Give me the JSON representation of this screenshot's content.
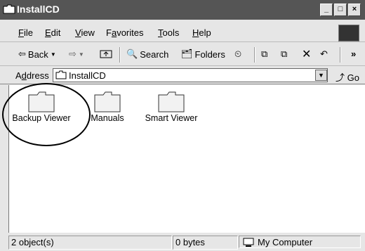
{
  "window": {
    "title": "InstallCD"
  },
  "menubar": {
    "file": "ile",
    "edit": "dit",
    "view": "iew",
    "favorites_pre": "F",
    "favorites_u": "a",
    "favorites_post": "vorites",
    "tools": "ools",
    "help": "elp"
  },
  "toolbar": {
    "back": "Back",
    "search": "Search",
    "folders": "Folders"
  },
  "address": {
    "label_u": "d",
    "label_pre": "A",
    "label_post": "dress",
    "value": "InstallCD",
    "go": "Go"
  },
  "files": [
    {
      "name": "Backup Viewer"
    },
    {
      "name": "Manuals"
    },
    {
      "name": "Smart Viewer"
    }
  ],
  "status": {
    "objects": "2 object(s)",
    "size": "0 bytes",
    "zone": "My Computer"
  }
}
